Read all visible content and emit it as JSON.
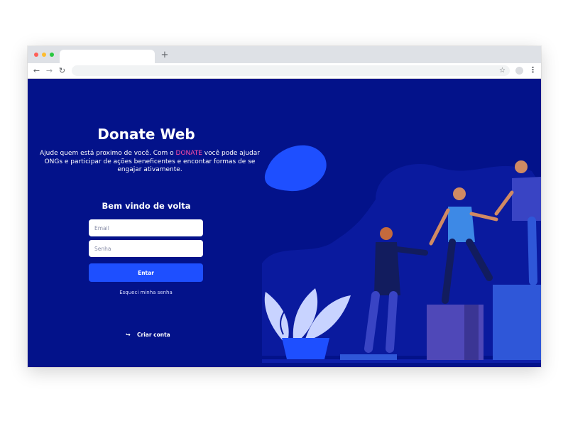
{
  "browser": {
    "tab_title": "",
    "new_tab_icon": "plus-icon",
    "back_icon": "arrow-left-icon",
    "forward_icon": "arrow-right-icon",
    "reload_icon": "reload-icon",
    "address": "",
    "bookmark_icon": "star-icon",
    "menu_icon": "kebab-menu-icon"
  },
  "login": {
    "title": "Donate Web",
    "description_before": "Ajude quem está proximo de você. Com o ",
    "description_brand": "DONATE",
    "description_after": " você pode ajudar ONGs e participar de ações beneficentes e encontar formas de se engajar ativamente.",
    "welcome": "Bem vindo de volta",
    "email_placeholder": "Email",
    "password_placeholder": "Senha",
    "submit_label": "Entar",
    "forgot_link": "Esqueci minha senha",
    "create_account": "Criar conta",
    "create_icon": "login-arrow-icon"
  },
  "colors": {
    "background": "#03128a",
    "primary_button": "#1e4fff",
    "brand_highlight": "#ff4da6"
  }
}
